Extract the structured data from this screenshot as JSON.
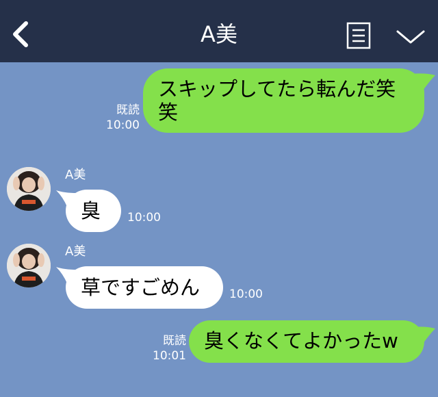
{
  "header": {
    "title": "A美",
    "back_icon": "chevron-left-icon",
    "menu_icon": "menu-icon",
    "expand_icon": "chevron-down-icon"
  },
  "colors": {
    "background": "#7494c5",
    "header": "#253049",
    "outgoing_bubble": "#84e04b",
    "incoming_bubble": "#ffffff"
  },
  "messages": [
    {
      "direction": "out",
      "text": "スキップしてたら転んだ笑\n笑",
      "read_label": "既読",
      "time": "10:00"
    },
    {
      "direction": "in",
      "sender": "A美",
      "text": "臭",
      "time": "10:00"
    },
    {
      "direction": "in",
      "sender": "A美",
      "text": "草ですごめん",
      "time": "10:00"
    },
    {
      "direction": "out",
      "text": "臭くなくてよかったw",
      "read_label": "既読",
      "time": "10:01"
    }
  ]
}
